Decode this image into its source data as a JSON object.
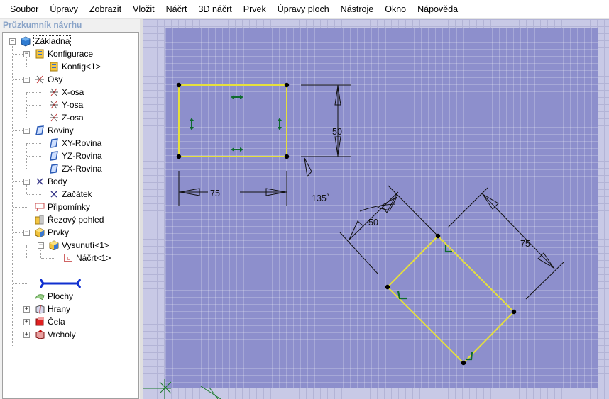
{
  "menu": [
    "Soubor",
    "Úpravy",
    "Zobrazit",
    "Vložit",
    "Náčrt",
    "3D náčrt",
    "Prvek",
    "Úpravy ploch",
    "Nástroje",
    "Okno",
    "Nápověda"
  ],
  "panel": {
    "title": "Průzkumník návrhu",
    "tree": {
      "root": "Základna",
      "konfigurace": "Konfigurace",
      "konfig1": "Konfig<1>",
      "osy": "Osy",
      "xosa": "X-osa",
      "yosa": "Y-osa",
      "zosa": "Z-osa",
      "roviny": "Roviny",
      "xy": "XY-Rovina",
      "yz": "YZ-Rovina",
      "zx": "ZX-Rovina",
      "body": "Body",
      "zacatek": "Začátek",
      "pripominky": "Připomínky",
      "rez": "Řezový pohled",
      "prvky": "Prvky",
      "vysunuti": "Vysunutí<1>",
      "nacrt": "Náčrt<1>",
      "plochy": "Plochy",
      "hrany": "Hrany",
      "cela": "Čela",
      "vrcholy": "Vrcholy"
    }
  },
  "sketch": {
    "dim_height": "50",
    "dim_width": "75",
    "dim_angle": "135˚",
    "dim_rot_short": "50",
    "dim_rot_long": "75"
  },
  "colors": {
    "canvas": "#8d8fcc",
    "sketch_line": "#e6e03c",
    "constraint": "#0f6b2e"
  }
}
